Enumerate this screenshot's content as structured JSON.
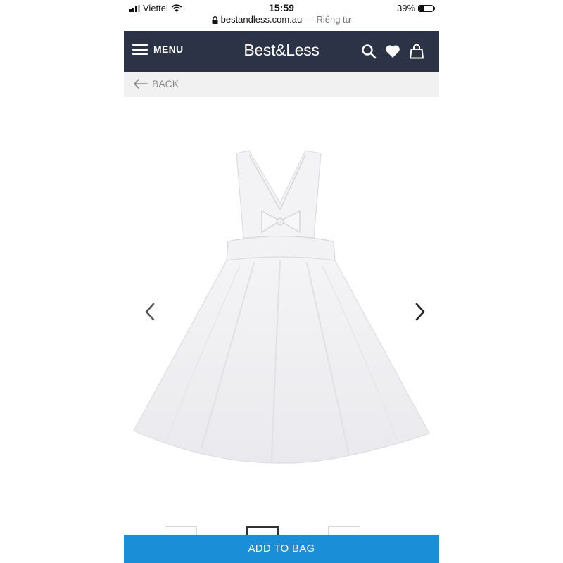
{
  "status_bar": {
    "carrier": "Viettel",
    "time": "15:59",
    "battery": "39%",
    "battery_level": 0.39
  },
  "url_bar": {
    "domain": "bestandless.com.au",
    "suffix": "— Riêng tư"
  },
  "header": {
    "menu_label": "MENU",
    "logo": "Best&Less",
    "icons": [
      "search-icon",
      "heart-icon",
      "bag-icon"
    ]
  },
  "nav": {
    "back_label": "BACK"
  },
  "gallery": {
    "image": "white-muslin-dress",
    "thumbnail_count": 3,
    "active_thumbnail": 2
  },
  "actions": {
    "add_to_bag_label": "ADD TO BAG"
  },
  "colors": {
    "header_bg": "#2d3346",
    "button_bg": "#1a8fd8",
    "backbar_bg": "#f1f1f1"
  }
}
